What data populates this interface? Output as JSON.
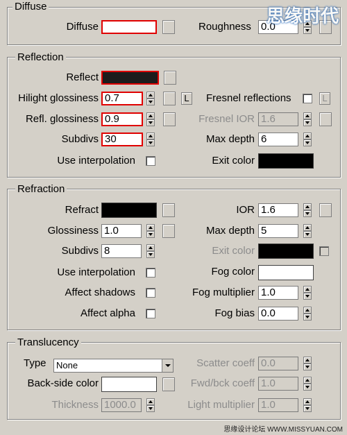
{
  "diffuse": {
    "title": "Diffuse",
    "diffuse_label": "Diffuse",
    "diffuse_color": "#ffffff",
    "roughness_label": "Roughness",
    "roughness_value": "0.0"
  },
  "reflection": {
    "title": "Reflection",
    "reflect_label": "Reflect",
    "reflect_color": "#1c1c1c",
    "hilight_label": "Hilight glossiness",
    "hilight_value": "0.7",
    "lock_label": "L",
    "fresnel_label": "Fresnel reflections",
    "fresnel_lock_label": "L",
    "refl_gloss_label": "Refl. glossiness",
    "refl_gloss_value": "0.9",
    "fresnel_ior_label": "Fresnel IOR",
    "fresnel_ior_value": "1.6",
    "subdivs_label": "Subdivs",
    "subdivs_value": "30",
    "max_depth_label": "Max depth",
    "max_depth_value": "6",
    "use_interp_label": "Use interpolation",
    "exit_color_label": "Exit color",
    "exit_color": "#000000"
  },
  "refraction": {
    "title": "Refraction",
    "refract_label": "Refract",
    "refract_color": "#000000",
    "ior_label": "IOR",
    "ior_value": "1.6",
    "glossiness_label": "Glossiness",
    "glossiness_value": "1.0",
    "max_depth_label": "Max depth",
    "max_depth_value": "5",
    "subdivs_label": "Subdivs",
    "subdivs_value": "8",
    "exit_color_label": "Exit color",
    "exit_color": "#000000",
    "use_interp_label": "Use interpolation",
    "fog_color_label": "Fog color",
    "fog_color": "#ffffff",
    "affect_shadows_label": "Affect shadows",
    "fog_mult_label": "Fog multiplier",
    "fog_mult_value": "1.0",
    "affect_alpha_label": "Affect alpha",
    "fog_bias_label": "Fog bias",
    "fog_bias_value": "0.0"
  },
  "translucency": {
    "title": "Translucency",
    "type_label": "Type",
    "type_value": "None",
    "scatter_label": "Scatter coeff",
    "scatter_value": "0.0",
    "backside_label": "Back-side color",
    "backside_color": "#ffffff",
    "fwdbck_label": "Fwd/bck coeff",
    "fwdbck_value": "1.0",
    "thickness_label": "Thickness",
    "thickness_value": "1000.0",
    "light_mult_label": "Light multiplier",
    "light_mult_value": "1.0"
  },
  "watermark": {
    "top": "思缘时代",
    "bottom": "思缘设计论坛 WWW.MISSYUAN.COM"
  },
  "colors": {
    "highlight": "#e00000",
    "panel": "#d4d0c8"
  }
}
